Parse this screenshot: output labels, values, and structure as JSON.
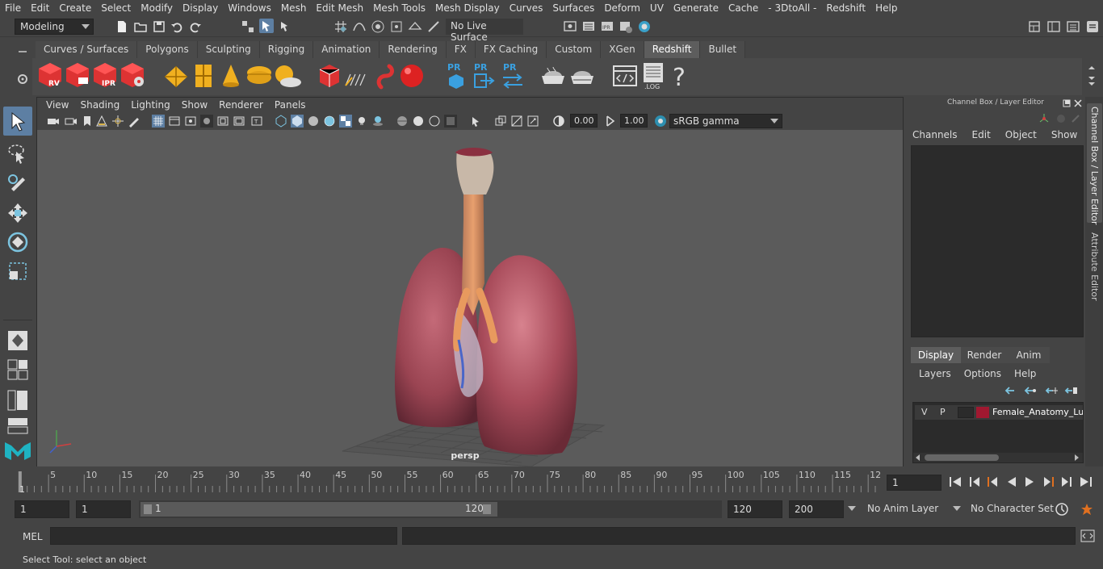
{
  "menubar": {
    "items": [
      "File",
      "Edit",
      "Create",
      "Select",
      "Modify",
      "Display",
      "Windows",
      "Mesh",
      "Edit Mesh",
      "Mesh Tools",
      "Mesh Display",
      "Curves",
      "Surfaces",
      "Deform",
      "UV",
      "Generate",
      "Cache",
      "- 3DtoAll -",
      "Redshift",
      "Help"
    ]
  },
  "statusline": {
    "mode": "Modeling",
    "live_surface": "No Live Surface"
  },
  "shelf": {
    "tabs": [
      "Curves / Surfaces",
      "Polygons",
      "Sculpting",
      "Rigging",
      "Animation",
      "Rendering",
      "FX",
      "FX Caching",
      "Custom",
      "XGen",
      "Redshift",
      "Bullet"
    ],
    "active_tab": "Redshift",
    "rv_label": "RV",
    "ipr_label": "IPR",
    "pr_label": "PR",
    "log_label": ".LOG",
    "help_glyph": "?"
  },
  "viewport": {
    "menu": [
      "View",
      "Shading",
      "Lighting",
      "Show",
      "Renderer",
      "Panels"
    ],
    "exposure": "0.00",
    "gamma": "1.00",
    "colorspace": "sRGB gamma",
    "camera_label": "persp"
  },
  "channel_box": {
    "title": "Channel Box / Layer Editor",
    "menu": [
      "Channels",
      "Edit",
      "Object",
      "Show"
    ]
  },
  "layer_editor": {
    "tabs": [
      "Display",
      "Render",
      "Anim"
    ],
    "active_tab": "Display",
    "menu": [
      "Layers",
      "Options",
      "Help"
    ],
    "layers": [
      {
        "v": "V",
        "p": "P",
        "color": "#a01830",
        "name": "Female_Anatomy_Lung"
      }
    ]
  },
  "side_tabs": {
    "channel_box": "Channel Box / Layer Editor",
    "attribute_editor": "Attribute Editor"
  },
  "timeline": {
    "ticks": [
      "5",
      "10",
      "15",
      "20",
      "25",
      "30",
      "35",
      "40",
      "45",
      "50",
      "55",
      "60",
      "65",
      "70",
      "75",
      "80",
      "85",
      "90",
      "95",
      "100",
      "105",
      "110",
      "115",
      "12"
    ],
    "start_label": "1",
    "current_frame": "1"
  },
  "range": {
    "start": "1",
    "playback_start": "1",
    "slider_start": "1",
    "slider_end": "120",
    "playback_end": "120",
    "end": "200",
    "anim_layer": "No Anim Layer",
    "character_set": "No Character Set"
  },
  "cmdline": {
    "label": "MEL"
  },
  "helpline": {
    "text": "Select Tool: select an object"
  }
}
